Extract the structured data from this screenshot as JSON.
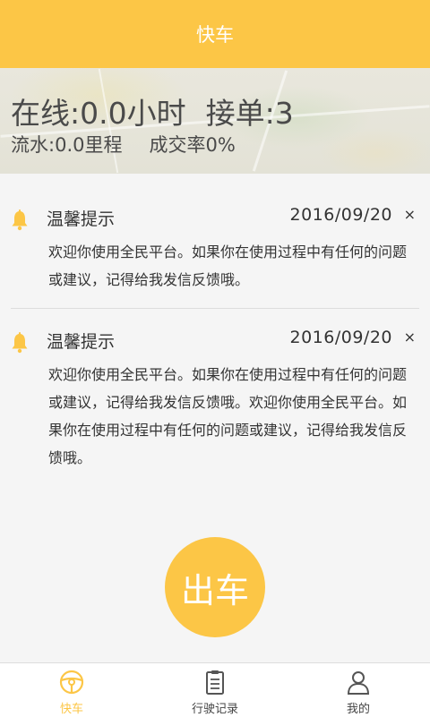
{
  "header": {
    "title": "快车"
  },
  "stats": {
    "online_label": "在线:",
    "online_value": "0.0",
    "online_unit": "小时",
    "orders_label": "接单:",
    "orders_value": "3",
    "flow_label": "流水:",
    "flow_value": "0.0",
    "flow_unit": "里程",
    "deal_rate_label": "成交率",
    "deal_rate_value": "0%"
  },
  "notices": [
    {
      "title": "温馨提示",
      "date": "2016/09/20",
      "close": "×",
      "icon": "bell-icon",
      "body": "欢迎你使用全民平台。如果你在使用过程中有任何的问题或建议，记得给我发信反馈哦。"
    },
    {
      "title": "温馨提示",
      "date": "2016/09/20",
      "close": "×",
      "icon": "bell-icon",
      "body": "欢迎你使用全民平台。如果你在使用过程中有任何的问题或建议，记得给我发信反馈哦。欢迎你使用全民平台。如果你在使用过程中有任何的问题或建议，记得给我发信反馈哦。"
    }
  ],
  "depart_button": {
    "label": "出车"
  },
  "tabbar": {
    "tabs": [
      {
        "label": "快车",
        "icon": "steering-wheel-icon",
        "active": true
      },
      {
        "label": "行驶记录",
        "icon": "clipboard-icon",
        "active": false
      },
      {
        "label": "我的",
        "icon": "user-icon",
        "active": false
      }
    ]
  },
  "colors": {
    "accent": "#fcc646",
    "text": "#333333",
    "background": "#f5f5f5"
  }
}
